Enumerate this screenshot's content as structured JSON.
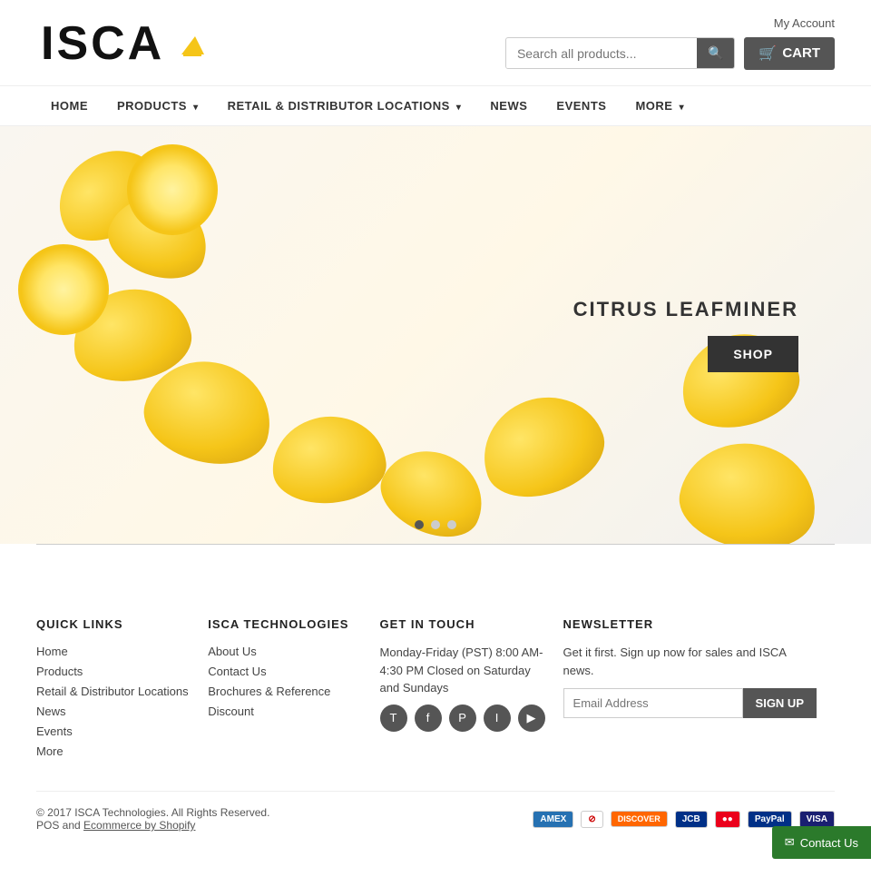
{
  "header": {
    "logo_text": "ISCA",
    "my_account_label": "My Account",
    "search_placeholder": "Search all products...",
    "cart_label": "CART"
  },
  "nav": {
    "items": [
      {
        "label": "HOME",
        "has_dropdown": false
      },
      {
        "label": "PRODUCTS",
        "has_dropdown": true
      },
      {
        "label": "RETAIL & DISTRIBUTOR LOCATIONS",
        "has_dropdown": true
      },
      {
        "label": "NEWS",
        "has_dropdown": false
      },
      {
        "label": "EVENTS",
        "has_dropdown": false
      },
      {
        "label": "MORE",
        "has_dropdown": true
      }
    ]
  },
  "hero": {
    "title": "CITRUS LEAFMINER",
    "shop_button": "SHOP"
  },
  "slider": {
    "dots": [
      {
        "active": true
      },
      {
        "active": false
      },
      {
        "active": false
      }
    ]
  },
  "footer": {
    "quick_links": {
      "heading": "QUICK LINKS",
      "items": [
        {
          "label": "Home"
        },
        {
          "label": "Products"
        },
        {
          "label": "Retail & Distributor Locations"
        },
        {
          "label": "News"
        },
        {
          "label": "Events"
        },
        {
          "label": "More"
        }
      ]
    },
    "isca_technologies": {
      "heading": "ISCA TECHNOLOGIES",
      "items": [
        {
          "label": "About Us"
        },
        {
          "label": "Contact Us"
        },
        {
          "label": "Brochures & Reference"
        },
        {
          "label": "Discount"
        }
      ]
    },
    "get_in_touch": {
      "heading": "GET IN TOUCH",
      "hours": "Monday-Friday (PST) 8:00 AM- 4:30 PM Closed on Saturday and Sundays",
      "social": {
        "twitter": "T",
        "facebook": "f",
        "pinterest": "P",
        "instagram": "I",
        "youtube": "▶"
      }
    },
    "newsletter": {
      "heading": "NEWSLETTER",
      "description": "Get it first. Sign up now for sales and ISCA news.",
      "email_placeholder": "Email Address",
      "signup_label": "SIGN UP"
    },
    "bottom": {
      "copyright": "© 2017 ISCA Technologies. All Rights Reserved.",
      "pos_text": "POS and",
      "ecommerce_text": "Ecommerce by Shopify"
    }
  },
  "contact_float": {
    "icon": "✉",
    "label": "Contact Us"
  }
}
